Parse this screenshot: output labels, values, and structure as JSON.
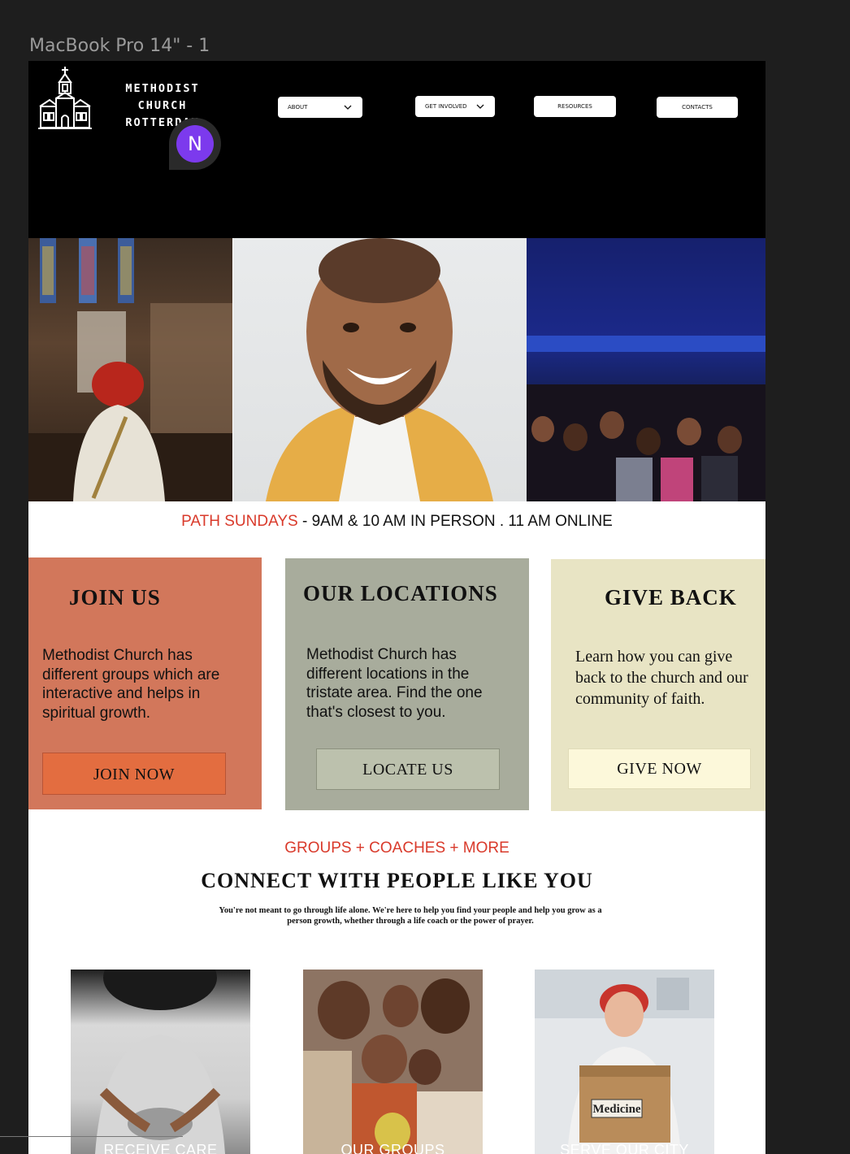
{
  "frame": {
    "label": "MacBook Pro 14\" - 1"
  },
  "header": {
    "logo_line1": "METHODIST CHURCH",
    "logo_line2": "ROTTERDAM",
    "avatar_initial": "N",
    "nav": {
      "about": "ABOUT",
      "get_involved": "GET INVOLVED",
      "resources": "RESOURCES",
      "contacts": "CONTACTS"
    }
  },
  "schedule": {
    "highlight": "PATH SUNDAYS",
    "rest": " - 9AM & 10 AM IN PERSON . 11 AM ONLINE"
  },
  "cards": {
    "join": {
      "title": "JOIN US",
      "text": "Methodist Church has different groups which are interactive and helps in spiritual growth.",
      "button": "JOIN NOW"
    },
    "locations": {
      "title": "OUR LOCATIONS",
      "text": "Methodist Church has different locations in the tristate area. Find the one that's closest to you.",
      "button": "LOCATE US"
    },
    "give": {
      "title": "GIVE BACK",
      "line1": "Learn how you can give",
      "line2": "back to the church and our",
      "line3": "community of faith.",
      "button": "GIVE NOW"
    }
  },
  "connect": {
    "label": "GROUPS + COACHES + MORE",
    "title": "CONNECT WITH PEOPLE LIKE YOU",
    "text": "You're not meant to go through life alone. We're here to help you find your people and help you grow as a person growth, whether through a life coach or the power of prayer.",
    "tiles": [
      {
        "label": "RECEIVE CARE"
      },
      {
        "label": "OUR GROUPS"
      },
      {
        "label": "SERVE OUR CITY"
      }
    ],
    "box_text": "Medicine"
  },
  "colors": {
    "header_bg": "#000000",
    "accent_red": "#d93a2b",
    "join_card": "#d2775b",
    "join_button": "#e36d40",
    "locations_card": "#a8ac9c",
    "locations_button": "#bcc1ad",
    "give_card": "#e8e4c4",
    "give_button": "#fcf8da",
    "avatar": "#7c3aed"
  }
}
